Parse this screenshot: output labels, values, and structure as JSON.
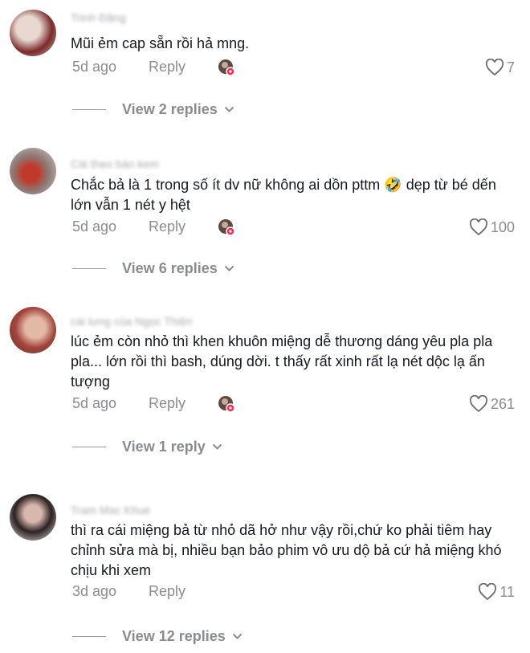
{
  "comments": [
    {
      "author": "Trinh Đặng",
      "text": "Mũi ẻm cap sẵn rồi hả mng.",
      "date": "5d ago",
      "reply_label": "Reply",
      "likes": "7",
      "view_replies": "View 2 replies",
      "avatar_colors": [
        "#c9b8b0",
        "#7a2a2a",
        "#e8d8d0"
      ]
    },
    {
      "author": "Cái thẹo bàn kem",
      "text": "Chắc bả là 1 trong số ít dv nữ không ai dồn pttm 🤣 dẹp từ bé dến lớn vẫn 1 nét y hệt",
      "date": "5d ago",
      "reply_label": "Reply",
      "likes": "100",
      "view_replies": "View 6 replies",
      "avatar_colors": [
        "#d9c7c2",
        "#c0392b",
        "#8c7b76"
      ]
    },
    {
      "author": "cái lưng của Ngọc Thiện",
      "text": "lúc ẻm còn nhỏ thì khen khuôn miệng dễ thương dáng yêu pla pla pla... lớn rồi thì bash, dúng dời. t thấy rất xinh rất lạ nét dộc lạ ấn tượng",
      "date": "5d ago",
      "reply_label": "Reply",
      "likes": "261",
      "view_replies": "View 1 reply",
      "avatar_colors": [
        "#e2b9a5",
        "#a3443c",
        "#5a3a30"
      ]
    },
    {
      "author": "Tram Mac Khue",
      "text": "thì ra cái miệng bả từ nhỏ dã hở như vậy rồi,chứ ko phải tiêm hay chỉnh sửa mà bị, nhiều bạn bảo phim vô ưu dộ bả cứ hả miệng khó chịu khi xem",
      "date": "3d ago",
      "reply_label": "Reply",
      "likes": "11",
      "view_replies": "View 12 replies",
      "avatar_colors": [
        "#f0e4e2",
        "#2b2222",
        "#d8b7ad"
      ]
    }
  ],
  "icons": {
    "like": "heart-outline-icon",
    "creator": "creator-avatar-icon",
    "expand": "chevron-down-icon"
  },
  "colors": {
    "text": "#161823",
    "muted": "#8a8b91",
    "creator_badge": "#fe2c55"
  }
}
